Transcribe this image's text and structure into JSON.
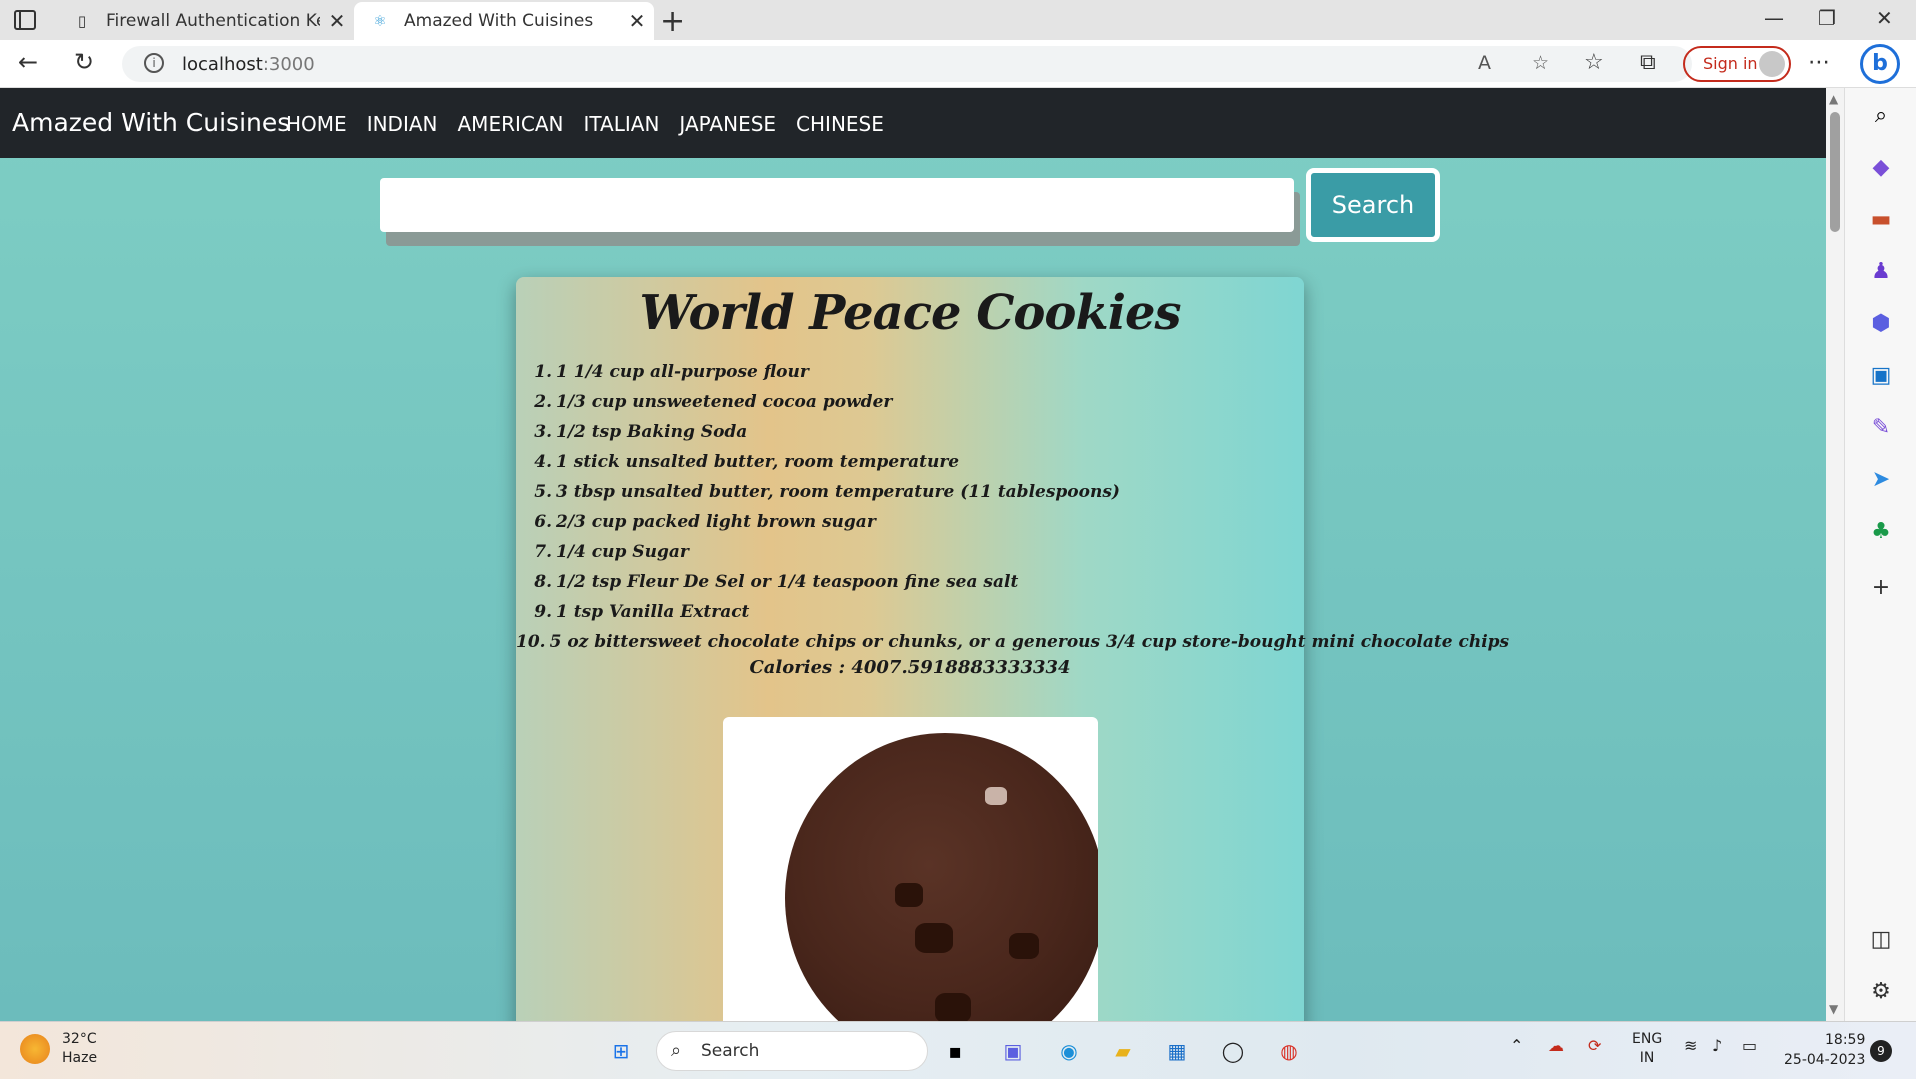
{
  "browser": {
    "tabs": [
      {
        "label": "Firewall Authentication Keepalive",
        "icon": "page-icon"
      },
      {
        "label": "Amazed With Cuisines",
        "icon": "react-icon"
      }
    ],
    "url_host": "localhost",
    "url_port": ":3000",
    "sign_in": "Sign in"
  },
  "app": {
    "brand": "Amazed With Cuisines",
    "menu": [
      "HOME",
      "INDIAN",
      "AMERICAN",
      "ITALIAN",
      "JAPANESE",
      "CHINESE"
    ],
    "search": {
      "value": "",
      "placeholder": "",
      "button": "Search"
    }
  },
  "recipe": {
    "title": "World Peace Cookies",
    "ingredients": [
      "1 1/4 cup all-purpose flour",
      "1/3 cup unsweetened cocoa powder",
      "1/2 tsp Baking Soda",
      "1 stick unsalted butter, room temperature",
      "3 tbsp unsalted butter, room temperature (11 tablespoons)",
      "2/3 cup packed light brown sugar",
      "1/4 cup Sugar",
      "1/2 tsp Fleur De Sel or 1/4 teaspoon fine sea salt",
      "1 tsp Vanilla Extract",
      "5 oz bittersweet chocolate chips or chunks, or a generous 3/4 cup store-bought mini chocolate chips"
    ],
    "calories": "Calories : 4007.5918883333334"
  },
  "taskbar": {
    "temp": "32°C",
    "condition": "Haze",
    "search": "Search",
    "lang1": "ENG",
    "lang2": "IN",
    "time": "18:59",
    "date": "25-04-2023",
    "notifications": "9"
  }
}
